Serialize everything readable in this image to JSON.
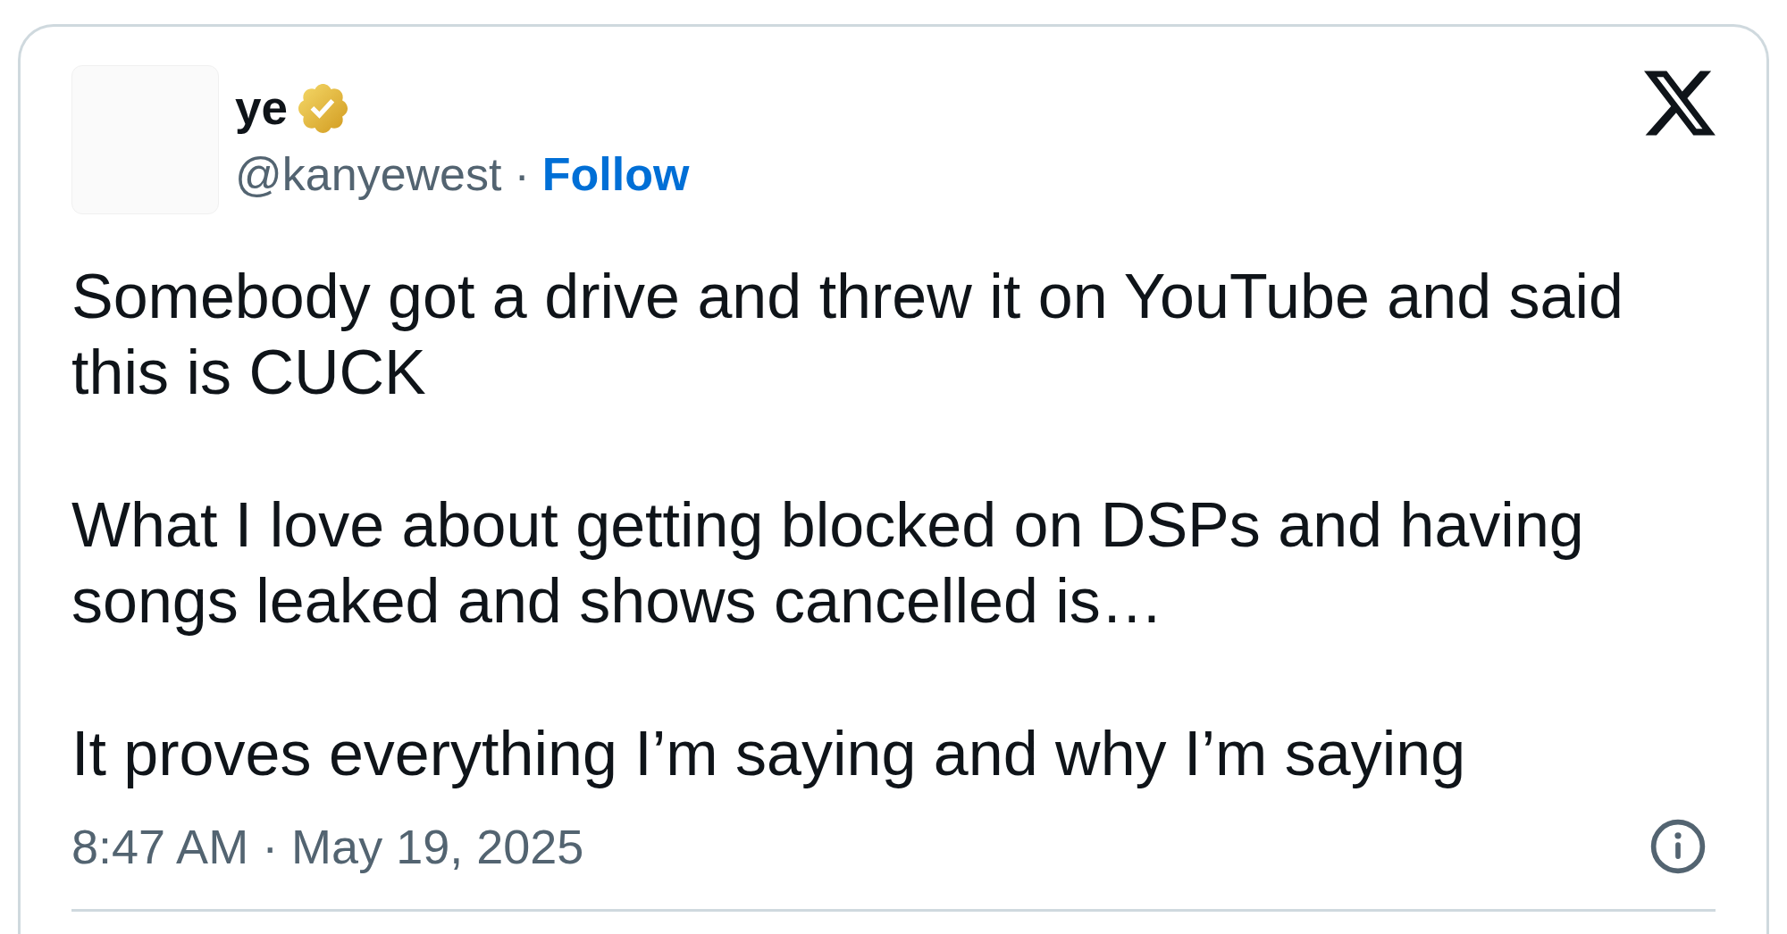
{
  "author": {
    "name": "ye",
    "verified": true,
    "handle": "@kanyewest",
    "separator": "·",
    "follow": "Follow"
  },
  "tweet": {
    "paragraphs": [
      "Somebody got a drive and threw it on YouTube and said this is CUCK",
      "What I love about getting blocked on DSPs and having songs leaked and shows cancelled is…",
      "It proves everything I’m saying and why I’m saying"
    ]
  },
  "timestamp": "8:47 AM · May 19, 2025"
}
